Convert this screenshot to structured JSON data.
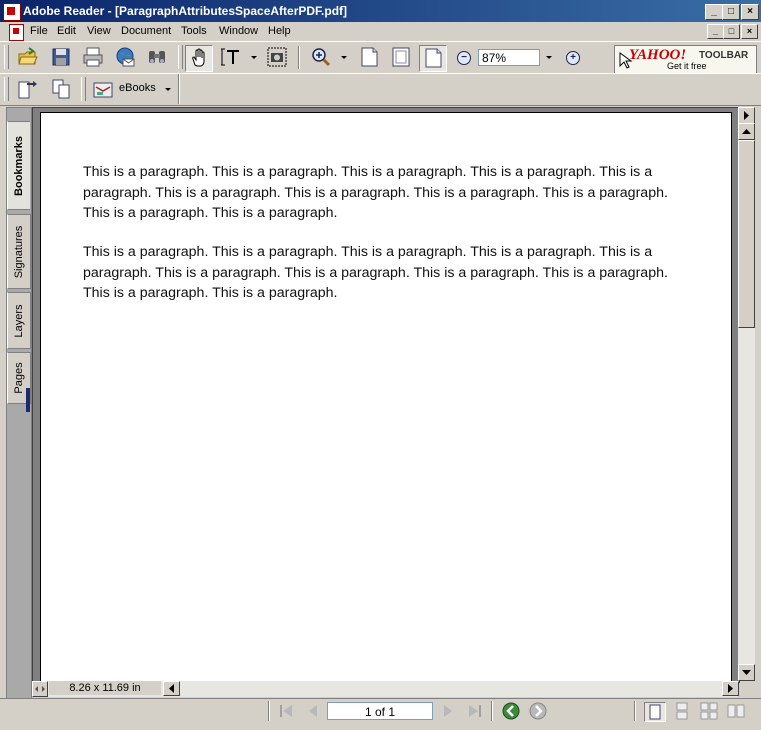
{
  "window": {
    "title": "Adobe Reader - [ParagraphAttributesSpaceAfterPDF.pdf]",
    "min_glyph": "_",
    "max_glyph": "□",
    "close_glyph": "×"
  },
  "menu": {
    "items": [
      "File",
      "Edit",
      "View",
      "Document",
      "Tools",
      "Window",
      "Help"
    ]
  },
  "toolbar": {
    "zoom_value": "87%",
    "zoom_out_glyph": "−",
    "zoom_in_glyph": "+",
    "ebooks_label": "eBooks"
  },
  "yahoo": {
    "brand": "YAHOO!",
    "product": "TOOLBAR",
    "tagline": "Get it free"
  },
  "side_tabs": [
    "Bookmarks",
    "Signatures",
    "Layers",
    "Pages"
  ],
  "document": {
    "paragraphs": [
      "This is a paragraph. This is a paragraph. This is a paragraph. This is a paragraph. This is a paragraph. This is a paragraph. This is a paragraph. This is a paragraph. This is a paragraph. This is a paragraph. This is a paragraph.",
      "This is a paragraph. This is a paragraph. This is a paragraph. This is a paragraph. This is a paragraph. This is a paragraph. This is a paragraph. This is a paragraph. This is a paragraph. This is a paragraph. This is a paragraph."
    ],
    "page_size": "8.26 x 11.69 in"
  },
  "navigation": {
    "page_indicator": "1 of 1"
  },
  "colors": {
    "title_start": "#0a246a",
    "title_end": "#3a6ea5",
    "chrome": "#d4d0c8",
    "nav_green": "#3c8a3c"
  }
}
